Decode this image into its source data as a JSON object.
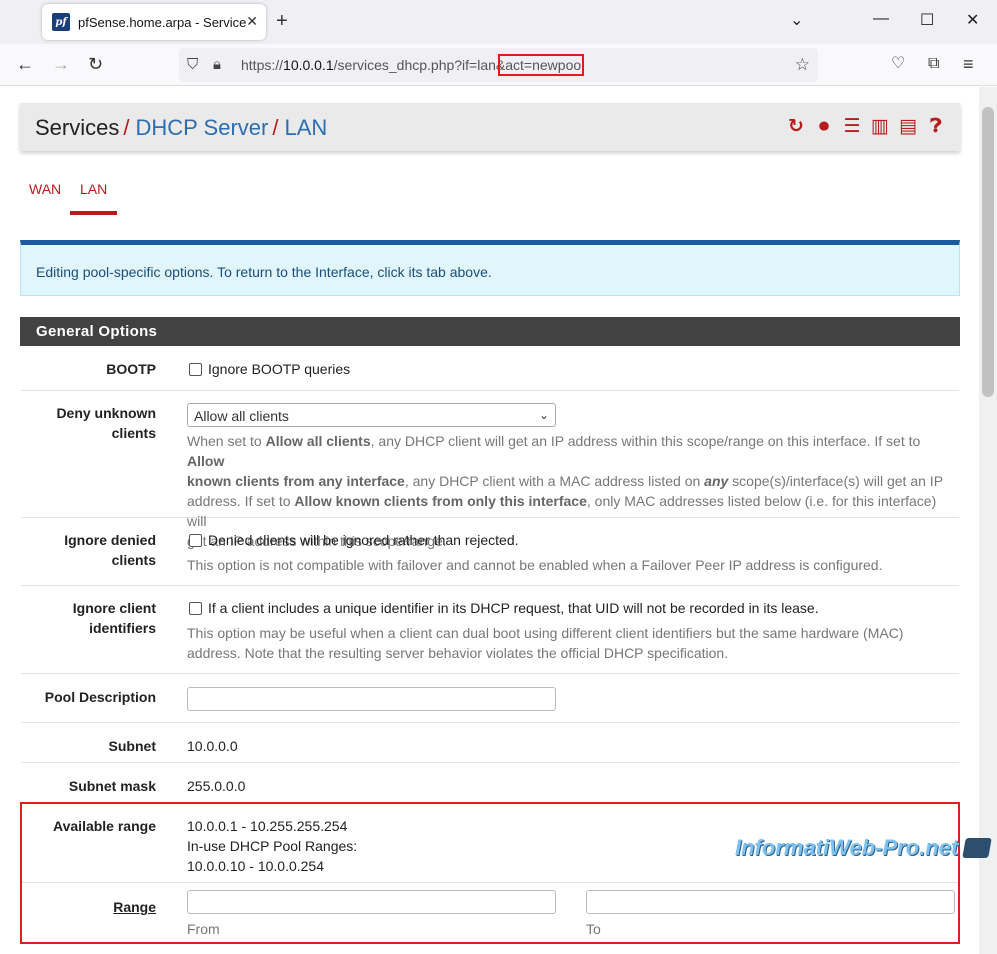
{
  "browser": {
    "tab_title": "pfSense.home.arpa - Services: D",
    "favicon_text": "pf",
    "new_tab": "+",
    "url_prefix": "https://",
    "url_host": "10.0.0.1",
    "url_path": "/services_dhcp.php?if=lan&act=newpool",
    "win": {
      "chevron": "⌄",
      "minimize": "—",
      "maximize": "☐",
      "close": "✕"
    }
  },
  "breadcrumb": {
    "services": "Services",
    "dhcp": "DHCP Server",
    "lan": "LAN",
    "sep": "/"
  },
  "header_icons": [
    "restart-icon",
    "stop-icon",
    "settings-icon",
    "chart-icon",
    "log-icon",
    "help-icon"
  ],
  "tabs": [
    "WAN",
    "LAN"
  ],
  "alert": "Editing pool-specific options. To return to the Interface, click its tab above.",
  "panel_title": "General Options",
  "bootp": {
    "label": "BOOTP",
    "checkbox": "Ignore BOOTP queries"
  },
  "deny": {
    "label1": "Deny unknown",
    "label2": "clients",
    "selected": "Allow all clients",
    "h1": "When set to ",
    "h1b": "Allow all clients",
    "h1c": ", any DHCP client will get an IP address within this scope/range on this interface. If set to ",
    "h1d": "Allow",
    "h2b": "known clients from any interface",
    "h2c": ", any DHCP client with a MAC address listed on ",
    "h2i": "any",
    "h2d": " scope(s)/interface(s) will get an IP",
    "h3a": "address. If set to ",
    "h3b": "Allow known clients from only this interface",
    "h3c": ", only MAC addresses listed below (i.e. for this interface) will",
    "h4": "get an IP address within this scope/range."
  },
  "ignore_denied": {
    "label1": "Ignore denied",
    "label2": "clients",
    "checkbox": "Denied clients will be ignored rather than rejected.",
    "help": "This option is not compatible with failover and cannot be enabled when a Failover Peer IP address is configured."
  },
  "ignore_uid": {
    "label1": "Ignore client",
    "label2": "identifiers",
    "checkbox": "If a client includes a unique identifier in its DHCP request, that UID will not be recorded in its lease.",
    "help1": "This option may be useful when a client can dual boot using different client identifiers but the same hardware (MAC)",
    "help2": "address. Note that the resulting server behavior violates the official DHCP specification."
  },
  "pool_description": {
    "label": "Pool Description",
    "value": ""
  },
  "subnet": {
    "label": "Subnet",
    "value": "10.0.0.0"
  },
  "subnet_mask": {
    "label": "Subnet mask",
    "value": "255.0.0.0"
  },
  "available_range": {
    "label": "Available range",
    "line1": "10.0.0.1 - 10.255.255.254",
    "line2": "In-use DHCP Pool Ranges:",
    "line3": "10.0.0.10 - 10.0.0.254"
  },
  "range": {
    "label": "Range",
    "from_label": "From",
    "to_label": "To",
    "from_value": "",
    "to_value": ""
  },
  "watermark": "InformatiWeb-Pro.net"
}
